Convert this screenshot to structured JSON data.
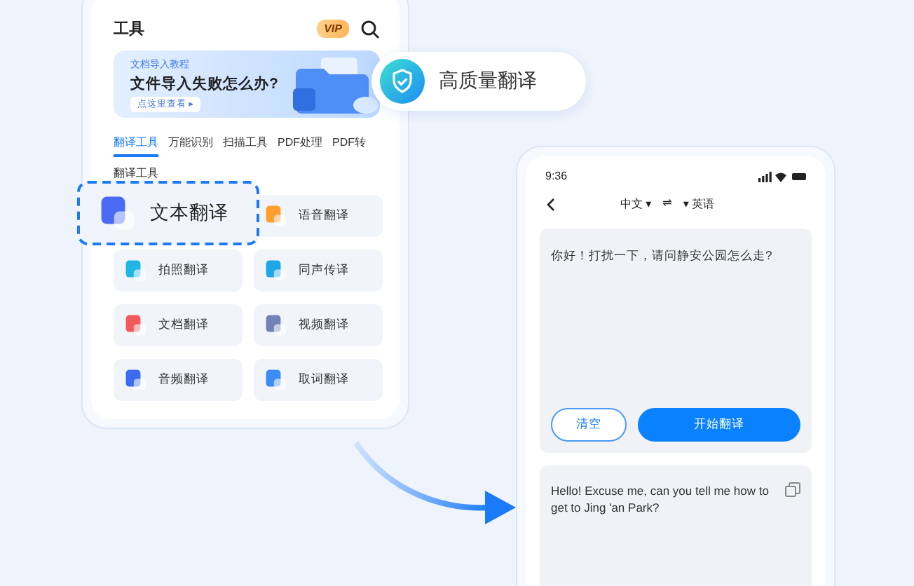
{
  "tools_screen": {
    "title": "工具",
    "vip_badge": "VIP",
    "banner": {
      "caption": "文档导入教程",
      "headline": "文件导入失败怎么办?",
      "link": "点这里查看 ▸"
    },
    "tabs": [
      {
        "label": "翻译工具",
        "selected": true
      },
      {
        "label": "万能识别",
        "selected": false
      },
      {
        "label": "扫描工具",
        "selected": false
      },
      {
        "label": "PDF处理",
        "selected": false
      },
      {
        "label": "PDF转",
        "selected": false
      }
    ],
    "section": "翻译工具",
    "tools": [
      {
        "label": "语音翻译",
        "color": "#ff9f2e"
      },
      {
        "label": "拍照翻译",
        "color": "#1fb6e6"
      },
      {
        "label": "同声传译",
        "color": "#1fa6e6"
      },
      {
        "label": "文档翻译",
        "color": "#f25a5a"
      },
      {
        "label": "视频翻译",
        "color": "#7082b8"
      },
      {
        "label": "音频翻译",
        "color": "#3b6cf0"
      },
      {
        "label": "取词翻译",
        "color": "#3c8cf5"
      }
    ]
  },
  "highlight_card": {
    "label": "文本翻译",
    "color": "#4a6cf5"
  },
  "quality_badge": {
    "label": "高质量翻译"
  },
  "translate_screen": {
    "time": "9:36",
    "source_language": "中文 ▾",
    "swap": "⇌",
    "target_language": "▾ 英语",
    "input_text": "你好！打扰一下，请问静安公园怎么走?",
    "clear_button": "清空",
    "translate_button": "开始翻译",
    "output_text": "Hello! Excuse me, can you tell me how to get to Jing 'an Park?"
  }
}
